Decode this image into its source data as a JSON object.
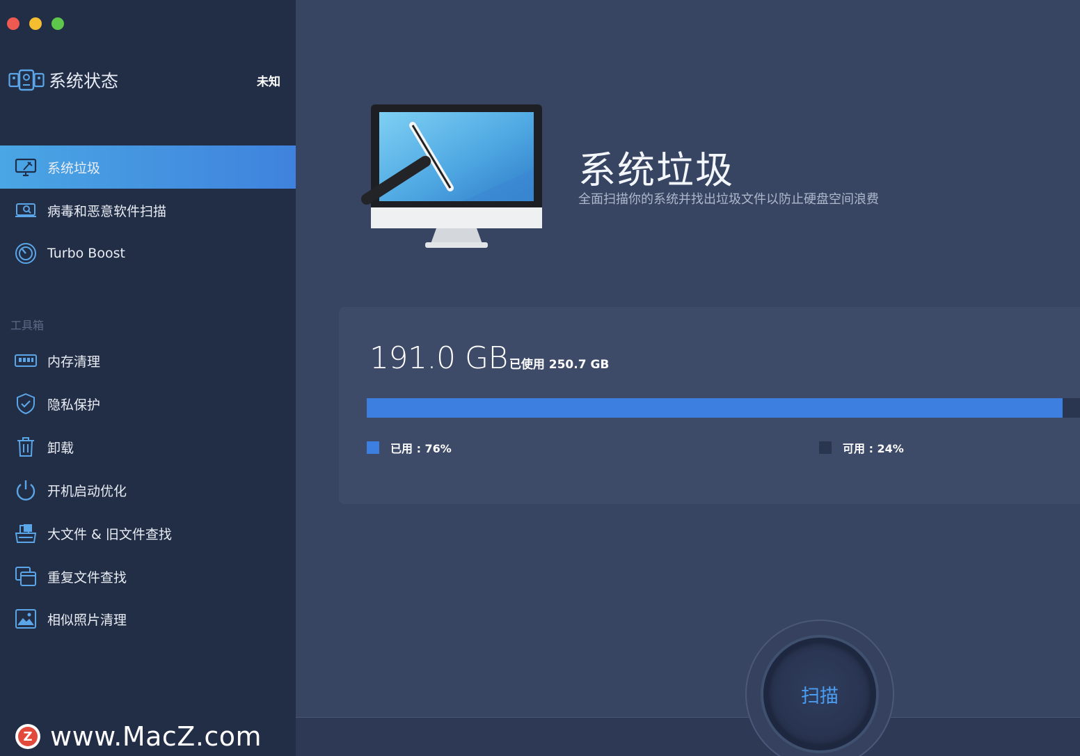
{
  "window": {
    "controls": [
      "close",
      "minimize",
      "zoom"
    ]
  },
  "sidebar": {
    "status": {
      "icon": "system-status-icon",
      "title": "系统状态",
      "value": "未知"
    },
    "main_items": [
      {
        "label": "系统垃圾",
        "icon": "monitor-broom-icon",
        "active": true
      },
      {
        "label": "病毒和恶意软件扫描",
        "icon": "scan-monitor-icon",
        "active": false
      },
      {
        "label": "Turbo Boost",
        "icon": "speedometer-icon",
        "active": false
      }
    ],
    "section_label": "工具箱",
    "tools": [
      {
        "label": "内存清理",
        "icon": "memory-chip-icon"
      },
      {
        "label": "隐私保护",
        "icon": "shield-check-icon"
      },
      {
        "label": "卸载",
        "icon": "trash-icon"
      },
      {
        "label": "开机启动优化",
        "icon": "power-icon"
      },
      {
        "label": "大文件 & 旧文件查找",
        "icon": "file-box-icon"
      },
      {
        "label": "重复文件查找",
        "icon": "duplicate-files-icon"
      },
      {
        "label": "相似照片清理",
        "icon": "photo-icon"
      }
    ]
  },
  "watermark": {
    "logo_letter": "Z",
    "text": "www.MacZ.com"
  },
  "main": {
    "hero": {
      "title": "系统垃圾",
      "subtitle": "全面扫描你的系统并找出垃圾文件以防止硬盘空间浪费"
    },
    "disk": {
      "size": "191.0 GB",
      "used_label": "已使用 250.7 GB",
      "used_fraction": 0.962,
      "legend_used": "已用 : 76%",
      "legend_free": "可用 : 24%"
    },
    "scan_button": "扫描"
  },
  "colors": {
    "accent": "#3d7fe0",
    "sidebar": "#222d46",
    "main": "#374462"
  }
}
